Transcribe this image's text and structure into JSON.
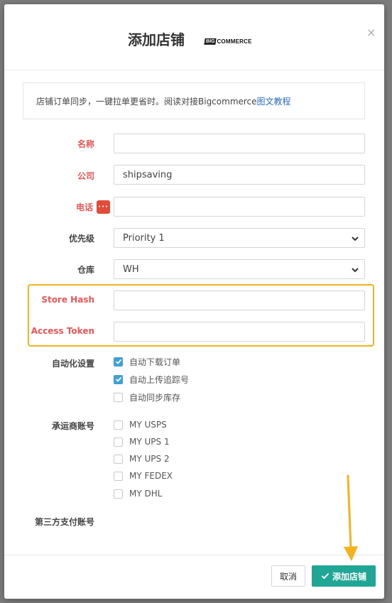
{
  "modal": {
    "title": "添加店铺",
    "brand_logo": {
      "mark": "BIG",
      "text": "COMMERCE"
    },
    "close_icon": "×"
  },
  "notice": {
    "text": "店铺订单同步，一键拉单更省时。阅读对接Bigcommerce",
    "link": "图文教程"
  },
  "fields": {
    "name": {
      "label": "名称",
      "value": "",
      "required": true
    },
    "company": {
      "label": "公司",
      "value": "shipsaving",
      "required": true
    },
    "phone": {
      "label": "电话",
      "value": "",
      "required": true,
      "badge": "···"
    },
    "priority": {
      "label": "优先级",
      "value": "Priority 1"
    },
    "warehouse": {
      "label": "仓库",
      "value": "WH"
    },
    "store_hash": {
      "label": "Store Hash",
      "value": "",
      "required": true
    },
    "access_token": {
      "label": "Access Token",
      "value": "",
      "required": true
    }
  },
  "automation": {
    "label": "自动化设置",
    "options": [
      {
        "label": "自动下载订单",
        "checked": true
      },
      {
        "label": "自动上传追踪号",
        "checked": true
      },
      {
        "label": "自动同步库存",
        "checked": false
      }
    ]
  },
  "carriers": {
    "label": "承运商账号",
    "options": [
      {
        "label": "MY USPS",
        "checked": false
      },
      {
        "label": "MY UPS 1",
        "checked": false
      },
      {
        "label": "MY UPS 2",
        "checked": false
      },
      {
        "label": "MY FEDEX",
        "checked": false
      },
      {
        "label": "MY DHL",
        "checked": false
      }
    ]
  },
  "third_party": {
    "label": "第三方支付账号"
  },
  "footer": {
    "cancel_label": "取消",
    "add_label": "添加店铺"
  },
  "colors": {
    "accent": "#21a695",
    "required": "#e85656",
    "highlight": "#f5b21c",
    "checkbox": "#3fa2d6",
    "link": "#2a6fc4"
  }
}
